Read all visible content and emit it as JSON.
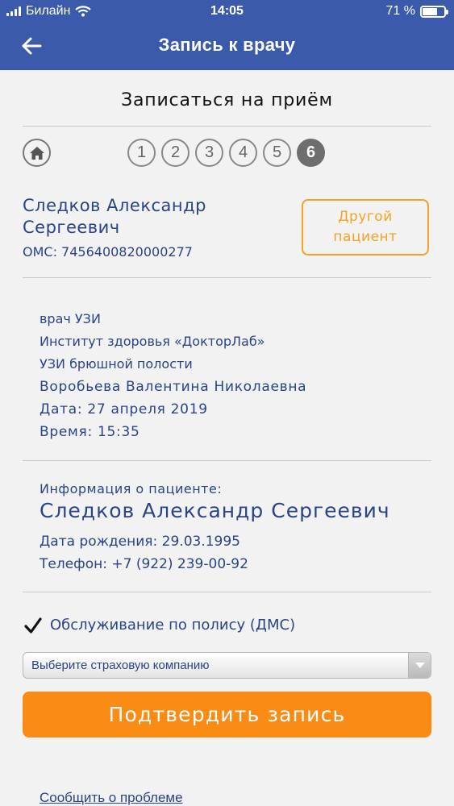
{
  "status_bar": {
    "carrier": "Билайн",
    "time": "14:05",
    "battery_text": "71 %",
    "battery_level": 0.71
  },
  "header": {
    "title": "Запись к врачу"
  },
  "page": {
    "title": "Записаться на приём"
  },
  "steps": {
    "items": [
      "1",
      "2",
      "3",
      "4",
      "5",
      "6"
    ],
    "active": "6"
  },
  "patient": {
    "name_line1": "Следков Александр",
    "name_line2": "Сергеевич",
    "oms": "ОМС: 7456400820000277",
    "other_button_line1": "Другой",
    "other_button_line2": "пациент"
  },
  "appointment": {
    "specialty": "врач УЗИ",
    "clinic": "Институт здоровья «ДокторЛаб»",
    "service": "УЗИ брюшной полости",
    "doctor": "Воробьева Валентина Николаевна",
    "date": "Дата: 27 апреля 2019",
    "time": "Время: 15:35"
  },
  "patient_info": {
    "heading": "Информация о пациенте:",
    "full_name": "Следков Александр Сергеевич",
    "birth": "Дата рождения: 29.03.1995",
    "phone": "Телефон: +7 (922) 239-00-92"
  },
  "policy": {
    "checked": true,
    "label": "Обслуживание по полису (ДМС)"
  },
  "insurance_select": {
    "value": "Выберите страховую компанию"
  },
  "confirm_button": {
    "label": "Подтвердить запись"
  },
  "report_link": {
    "label": "Сообщить о проблеме"
  },
  "colors": {
    "header_bg": "#3b5aac",
    "text_blue": "#2a4489",
    "accent_orange": "#fa8c16",
    "outline_orange": "#f7a223"
  }
}
